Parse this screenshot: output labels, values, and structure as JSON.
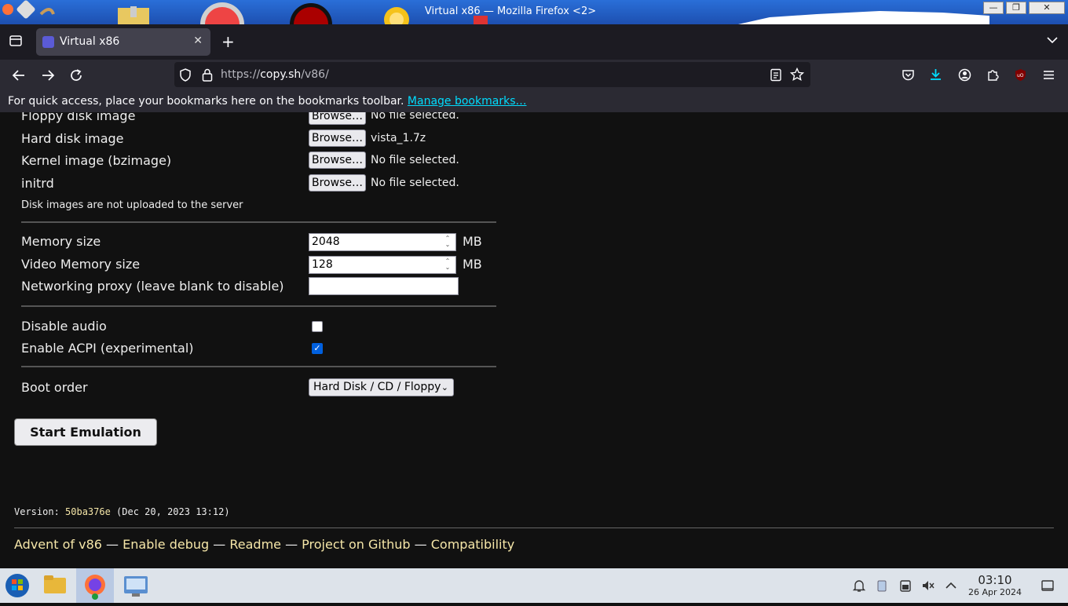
{
  "window": {
    "title": "Virtual x86 — Mozilla Firefox <2>",
    "min_label": "—",
    "max_label": "❐",
    "close_label": "✕"
  },
  "tabs": [
    {
      "label": "Virtual x86",
      "close_label": "✕",
      "active": true
    }
  ],
  "toolbar": {
    "new_tab_label": "+",
    "url_prefix": "https://",
    "url_host": "copy.sh",
    "url_path": "/v86/"
  },
  "bookmarks_bar": {
    "message": "For quick access, place your bookmarks here on the bookmarks toolbar.",
    "manage_link": "Manage bookmarks…"
  },
  "form": {
    "files": [
      {
        "label": "Floppy disk image",
        "button": "Browse…",
        "status": "No file selected."
      },
      {
        "label": "Hard disk image",
        "button": "Browse…",
        "status": "vista_1.7z"
      },
      {
        "label": "Kernel image (bzimage)",
        "button": "Browse…",
        "status": "No file selected."
      },
      {
        "label": "initrd",
        "button": "Browse…",
        "status": "No file selected."
      }
    ],
    "upload_note": "Disk images are not uploaded to the server",
    "memory_label": "Memory size",
    "memory_value": "2048",
    "memory_unit": "MB",
    "vmemory_label": "Video Memory size",
    "vmemory_value": "128",
    "vmemory_unit": "MB",
    "proxy_label": "Networking proxy (leave blank to disable)",
    "proxy_value": "",
    "disable_audio_label": "Disable audio",
    "disable_audio_checked": false,
    "acpi_label": "Enable ACPI (experimental)",
    "acpi_checked": true,
    "boot_order_label": "Boot order",
    "boot_order_value": "Hard Disk / CD / Floppy",
    "start_button": "Start Emulation"
  },
  "version": {
    "prefix": "Version: ",
    "hash": "50ba376e",
    "date": " (Dec 20, 2023 13:12)"
  },
  "footer_links": [
    "Advent of v86",
    "Enable debug",
    "Readme",
    "Project on Github",
    "Compatibility"
  ],
  "footer_separator": " — ",
  "taskbar": {
    "time": "03:10",
    "date": "26 Apr 2024"
  },
  "colors": {
    "link_accent": "#00ddff",
    "footer_link": "#f5e6a8",
    "checkbox_accent": "#0060df"
  }
}
